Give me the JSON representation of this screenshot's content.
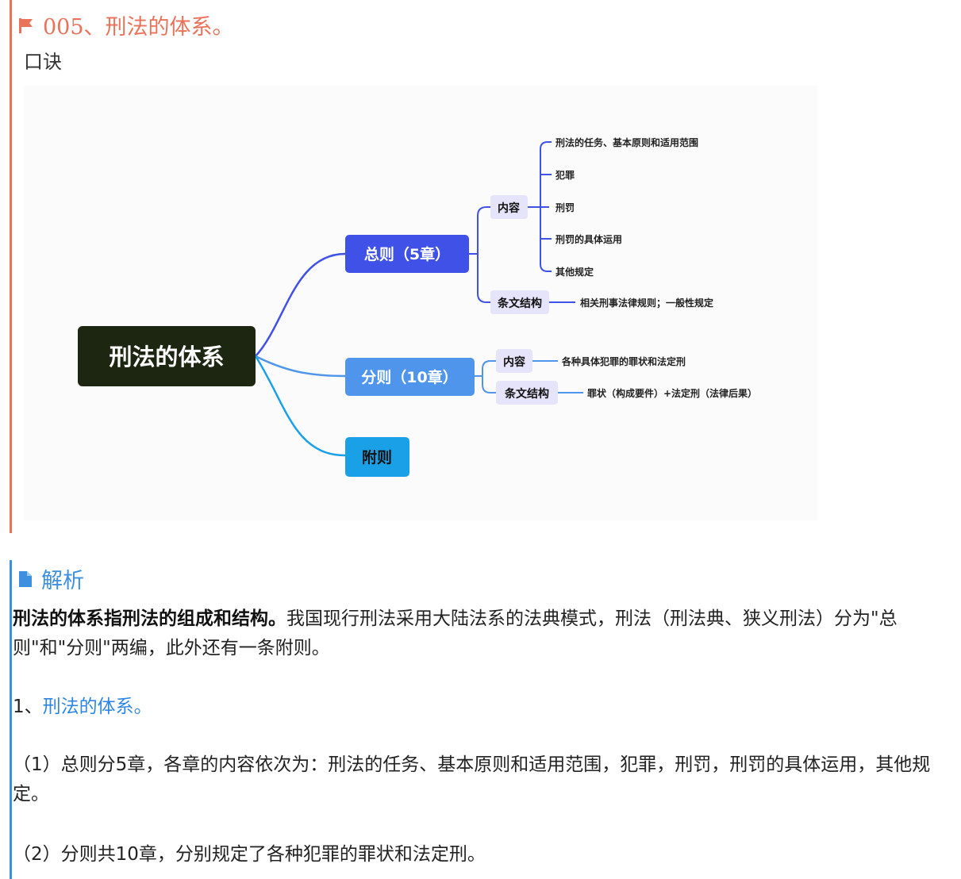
{
  "header": {
    "title": "005、刑法的体系。",
    "subtitle": "口诀",
    "flag_color": "#e8735a"
  },
  "mindmap": {
    "root": "刑法的体系",
    "general": {
      "label": "总则（5章）",
      "content_label": "内容",
      "content_items": [
        "刑法的任务、基本原则和适用范围",
        "犯罪",
        "刑罚",
        "刑罚的具体运用",
        "其他规定"
      ],
      "structure_label": "条文结构",
      "structure_item": "相关刑事法律规则；一般性规定"
    },
    "specific": {
      "label": "分则（10章）",
      "content_label": "内容",
      "content_item": "各种具体犯罪的罪状和法定刑",
      "structure_label": "条文结构",
      "structure_item": "罪状（构成要件）+法定刑（法律后果）"
    },
    "appendix": {
      "label": "附则"
    },
    "colors": {
      "root": "#1c2610",
      "general": "#3f51e6",
      "specific": "#4f95ec",
      "appendix": "#1aa0e6",
      "sub_bg": "#e6e4fb"
    }
  },
  "analysis": {
    "title": "解析",
    "accent": "#3d8fe0",
    "p1_bold": "刑法的体系指刑法的组成和结构。",
    "p1_rest": "我国现行刑法采用大陆法系的法典模式，刑法（刑法典、狭义刑法）分为\"总则\"和\"分则\"两编，此外还有一条附则。",
    "p2_prefix": "1、",
    "p2_link": "刑法的体系。",
    "p3": "（1）总则分5章，各章的内容依次为：刑法的任务、基本原则和适用范围，犯罪，刑罚，刑罚的具体运用，其他规定。",
    "p4": "（2）分则共10章，分别规定了各种犯罪的罪状和法定刑。"
  }
}
